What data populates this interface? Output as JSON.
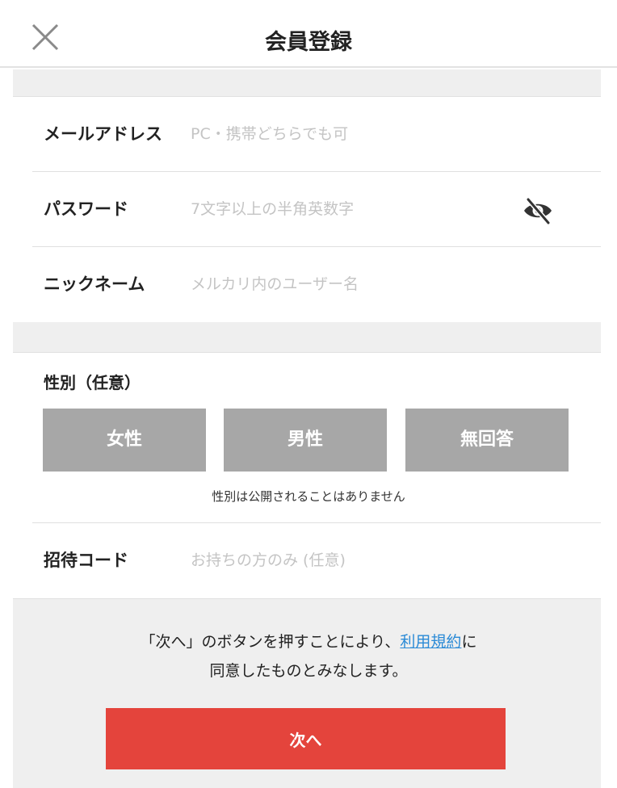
{
  "header": {
    "title": "会員登録",
    "close_icon": "close-icon"
  },
  "form": {
    "email": {
      "label": "メールアドレス",
      "placeholder": "PC・携帯どちらでも可",
      "value": ""
    },
    "password": {
      "label": "パスワード",
      "placeholder": "7文字以上の半角英数字",
      "value": "",
      "toggle_icon": "eye-slash-icon"
    },
    "nickname": {
      "label": "ニックネーム",
      "placeholder": "メルカリ内のユーザー名",
      "value": ""
    },
    "gender": {
      "label": "性別（任意）",
      "options": [
        "女性",
        "男性",
        "無回答"
      ],
      "note": "性別は公開されることはありません"
    },
    "invite": {
      "label": "招待コード",
      "placeholder": "お持ちの方のみ (任意)",
      "value": ""
    }
  },
  "footer": {
    "terms_prefix": "「次へ」のボタンを押すことにより、",
    "terms_link": "利用規約",
    "terms_suffix": "に",
    "terms_line2": "同意したものとみなします。",
    "next_label": "次へ"
  },
  "colors": {
    "accent_red": "#e4443c",
    "link_blue": "#2a8ad6",
    "gender_button": "#a7a7a7",
    "section_gray": "#efefef"
  }
}
